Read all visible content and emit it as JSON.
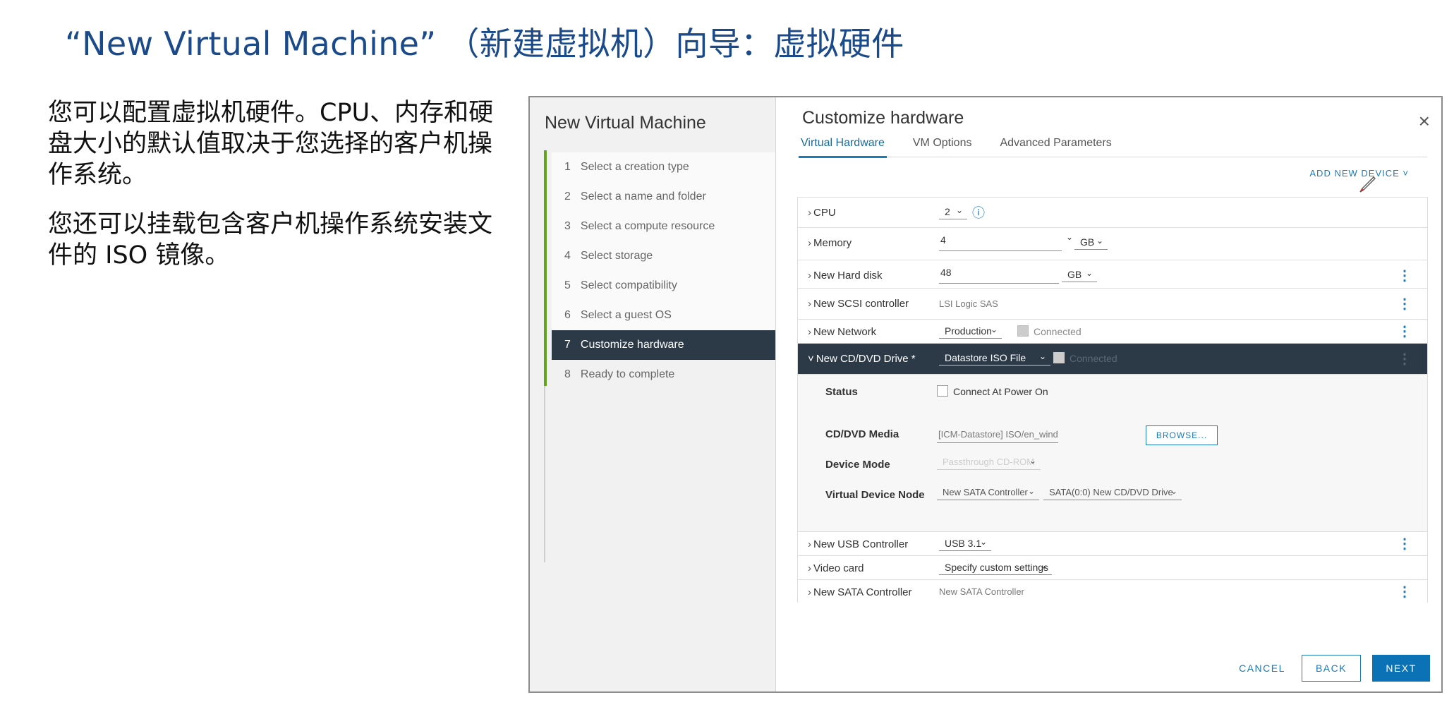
{
  "slide": {
    "title": "“New Virtual Machine” （新建虚拟机）向导：虚拟硬件",
    "para1": "您可以配置虚拟机硬件。CPU、内存和硬盘大小的默认值取决于您选择的客户机操作系统。",
    "para2": "您还可以挂载包含客户机操作系统安装文件的 ISO 镜像。"
  },
  "dialog": {
    "nav_title": "New Virtual Machine",
    "steps": [
      {
        "num": "1",
        "label": "Select a creation type"
      },
      {
        "num": "2",
        "label": "Select a name and folder"
      },
      {
        "num": "3",
        "label": "Select a compute resource"
      },
      {
        "num": "4",
        "label": "Select storage"
      },
      {
        "num": "5",
        "label": "Select compatibility"
      },
      {
        "num": "6",
        "label": "Select a guest OS"
      },
      {
        "num": "7",
        "label": "Customize hardware"
      },
      {
        "num": "8",
        "label": "Ready to complete"
      }
    ],
    "title": "Customize hardware",
    "close": "×",
    "tabs": [
      "Virtual Hardware",
      "VM Options",
      "Advanced Parameters"
    ],
    "add_device": "ADD NEW DEVICE ˅",
    "rows": {
      "cpu": {
        "label": "CPU",
        "value": "2",
        "info": "ⓘ"
      },
      "memory": {
        "label": "Memory",
        "value": "4",
        "unit": "GB"
      },
      "disk": {
        "label": "New Hard disk",
        "value": "48",
        "unit": "GB"
      },
      "scsi": {
        "label": "New SCSI controller",
        "value": "LSI Logic SAS"
      },
      "network": {
        "label": "New Network",
        "value": "Production",
        "connected": "Connected"
      },
      "cddvd": {
        "label": "New CD/DVD Drive *",
        "value": "Datastore ISO File",
        "connected": "Connected"
      },
      "usb": {
        "label": "New USB Controller",
        "value": "USB 3.1"
      },
      "video": {
        "label": "Video card",
        "value": "Specify custom settings"
      },
      "sata": {
        "label": "New SATA Controller",
        "value": "New SATA Controller"
      }
    },
    "cd_details": {
      "status_label": "Status",
      "status_value": "Connect At Power On",
      "media_label": "CD/DVD Media",
      "media_value": "[ICM-Datastore] ISO/en_windo",
      "browse": "BROWSE...",
      "mode_label": "Device Mode",
      "mode_value": "Passthrough CD-ROM",
      "node_label": "Virtual Device Node",
      "node_controller": "New SATA Controller",
      "node_slot": "SATA(0:0) New CD/DVD Drive"
    },
    "footer": {
      "cancel": "CANCEL",
      "back": "BACK",
      "next": "NEXT"
    }
  }
}
